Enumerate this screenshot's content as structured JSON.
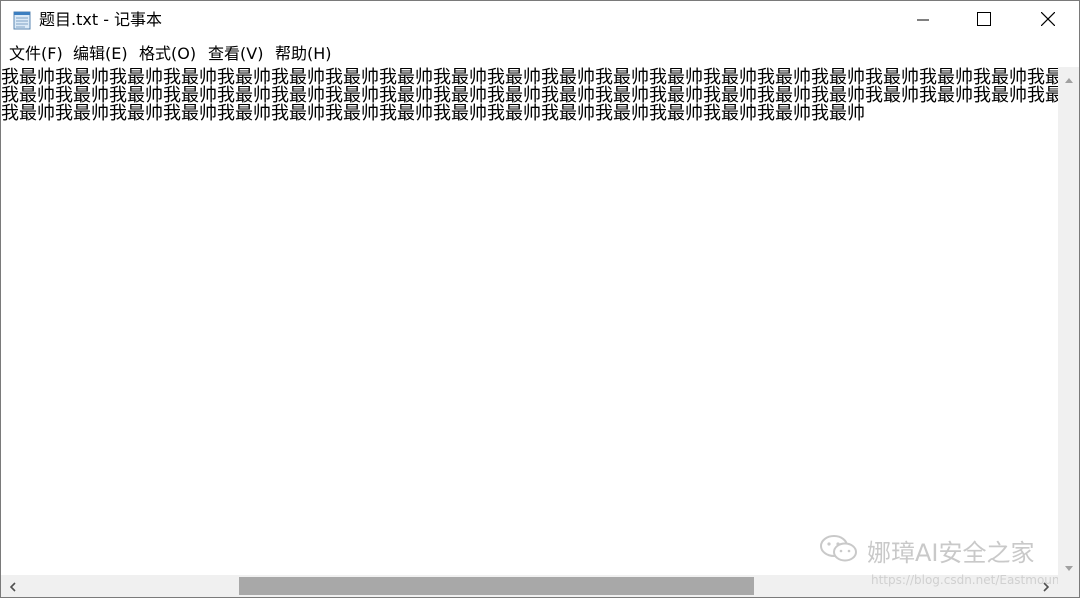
{
  "window": {
    "title": "题目.txt - 记事本"
  },
  "menu": [
    {
      "label": "文件(F)"
    },
    {
      "label": "编辑(E)"
    },
    {
      "label": "格式(O)"
    },
    {
      "label": "查看(V)"
    },
    {
      "label": "帮助(H)"
    }
  ],
  "editor": {
    "lines": [
      "我最帅我最帅我最帅我最帅我最帅我最帅我最帅我最帅我最帅我最帅我最帅我最帅我最帅我最帅我最帅我最帅我最帅我最帅我最帅我最",
      "我最帅我最帅我最帅我最帅我最帅我最帅我最帅我最帅我最帅我最帅我最帅我最帅我最帅我最帅我最帅我最帅我最帅我最帅我最帅我最",
      "我最帅我最帅我最帅我最帅我最帅我最帅我最帅我最帅我最帅我最帅我最帅我最帅我最帅我最帅我最帅我最帅"
    ]
  },
  "watermark": {
    "brand": "娜璋AI安全之家",
    "url": "https://blog.csdn.net/Eastmount"
  },
  "colors": {
    "scrollbar_track": "#f0f0f0",
    "scrollbar_thumb": "#a8a8a8",
    "watermark": "#c9c9c9"
  },
  "icons": {
    "app": "notepad-icon",
    "minimize": "minimize-icon",
    "maximize": "maximize-icon",
    "close": "close-icon",
    "scroll_up": "triangle-up-icon",
    "scroll_down": "triangle-down-icon",
    "scroll_left": "chevron-left-icon",
    "scroll_right": "chevron-right-icon",
    "wechat": "wechat-icon"
  }
}
